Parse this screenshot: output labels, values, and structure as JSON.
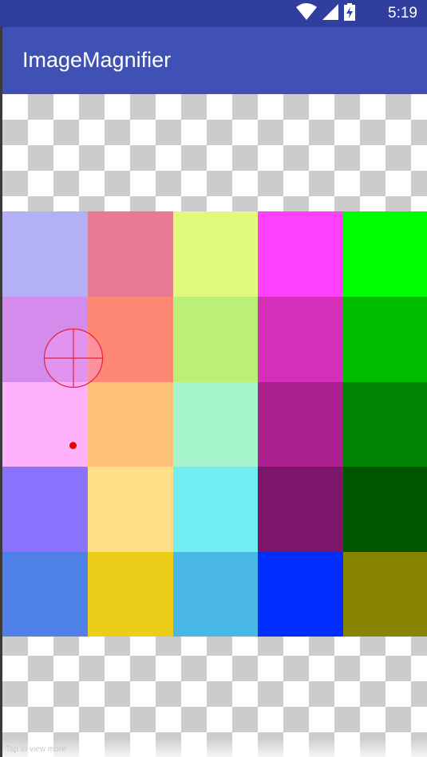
{
  "status_bar": {
    "time": "5:19",
    "icons": [
      "wifi-icon",
      "signal-icon",
      "battery-charging-icon"
    ]
  },
  "app_bar": {
    "title": "ImageMagnifier"
  },
  "image_grid": {
    "rows": 5,
    "columns": 5,
    "colors": [
      [
        "#b4b0f8",
        "#e87a96",
        "#e1fa7c",
        "#fe40fc",
        "#00ff00"
      ],
      [
        "#d38cec",
        "#fe8874",
        "#b9f075",
        "#d52eb9",
        "#00bd00"
      ],
      [
        "#feb2fc",
        "#fec17a",
        "#a6f4cc",
        "#ab1f8f",
        "#008300"
      ],
      [
        "#8a72fd",
        "#fede86",
        "#72eef3",
        "#7d166b",
        "#005600"
      ],
      [
        "#4e80e8",
        "#ecce1a",
        "#4ab8e6",
        "#002cfd",
        "#888300"
      ]
    ]
  },
  "magnifier": {
    "color": "#e8203c"
  },
  "footer": {
    "hint": "Tap to view more"
  }
}
